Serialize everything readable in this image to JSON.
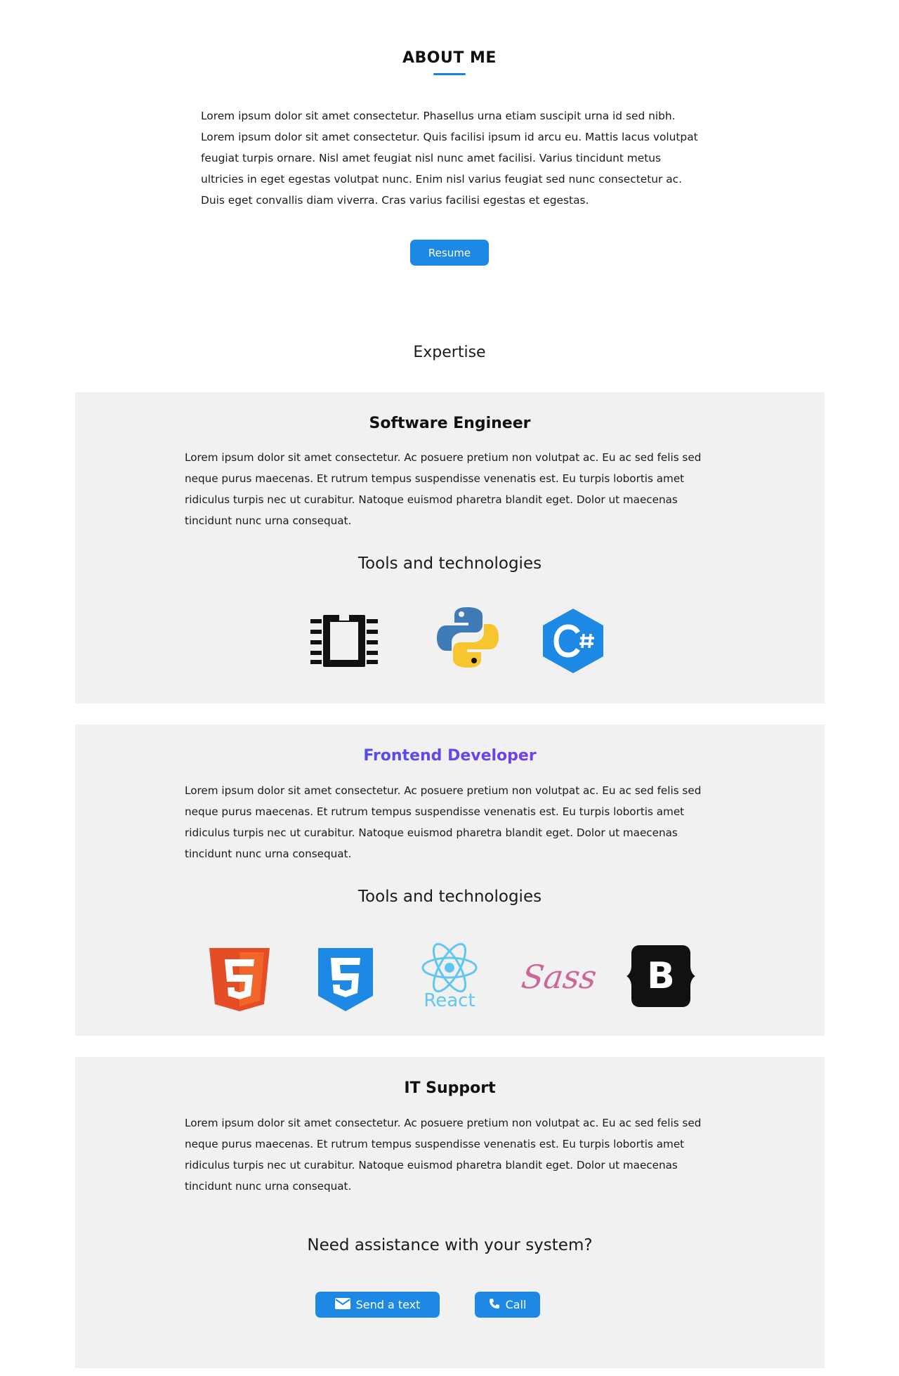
{
  "about": {
    "title": "ABOUT ME",
    "paragraph": "Lorem ipsum dolor sit amet consectetur. Phasellus urna etiam suscipit urna id sed nibh. Lorem ipsum dolor sit amet consectetur. Quis facilisi ipsum id arcu eu. Mattis lacus volutpat feugiat turpis ornare. Nisl amet feugiat nisl nunc amet facilisi. Varius tincidunt metus ultricies in eget egestas volutpat nunc. Enim nisl varius feugiat sed nunc consectetur ac. Duis eget convallis diam viverra. Cras varius facilisi egestas et egestas.",
    "resume_label": "Resume",
    "accent_color": "#1e88e5"
  },
  "expertise": {
    "title": "Expertise",
    "cards": [
      {
        "title": "Software Engineer",
        "text": "Lorem ipsum dolor sit amet consectetur. Ac posuere pretium non volutpat ac. Eu ac sed felis sed neque purus maecenas. Et rutrum tempus suspendisse venenatis est. Eu turpis lobortis amet ridiculus turpis nec ut curabitur. Natoque euismod pharetra blandit eget. Dolor ut maecenas tincidunt nunc urna consequat.",
        "tools_title": "Tools and technologies",
        "icons": [
          "microchip-icon",
          "python-icon",
          "csharp-icon"
        ]
      },
      {
        "title": "Frontend Developer",
        "text": "Lorem ipsum dolor sit amet consectetur. Ac posuere pretium non volutpat ac. Eu ac sed felis sed neque purus maecenas. Et rutrum tempus suspendisse venenatis est. Eu turpis lobortis amet ridiculus turpis nec ut curabitur. Natoque euismod pharetra blandit eget. Dolor ut maecenas tincidunt nunc urna consequat.",
        "tools_title": "Tools and technologies",
        "icons": [
          "html5-icon",
          "css3-icon",
          "react-icon",
          "sass-icon",
          "bootstrap-icon"
        ],
        "react_label": "React",
        "sass_label": "Sass",
        "bootstrap_label": "B"
      },
      {
        "title": "IT Support",
        "text": "Lorem ipsum dolor sit amet consectetur. Ac posuere pretium non volutpat ac. Eu ac sed felis sed neque purus maecenas. Et rutrum tempus suspendisse venenatis est. Eu turpis lobortis amet ridiculus turpis nec ut curabitur. Natoque euismod pharetra blandit eget. Dolor ut maecenas tincidunt nunc urna consequat.",
        "assist_title": "Need assistance with your system?",
        "send_text_label": "Send a text",
        "call_label": "Call"
      }
    ]
  }
}
